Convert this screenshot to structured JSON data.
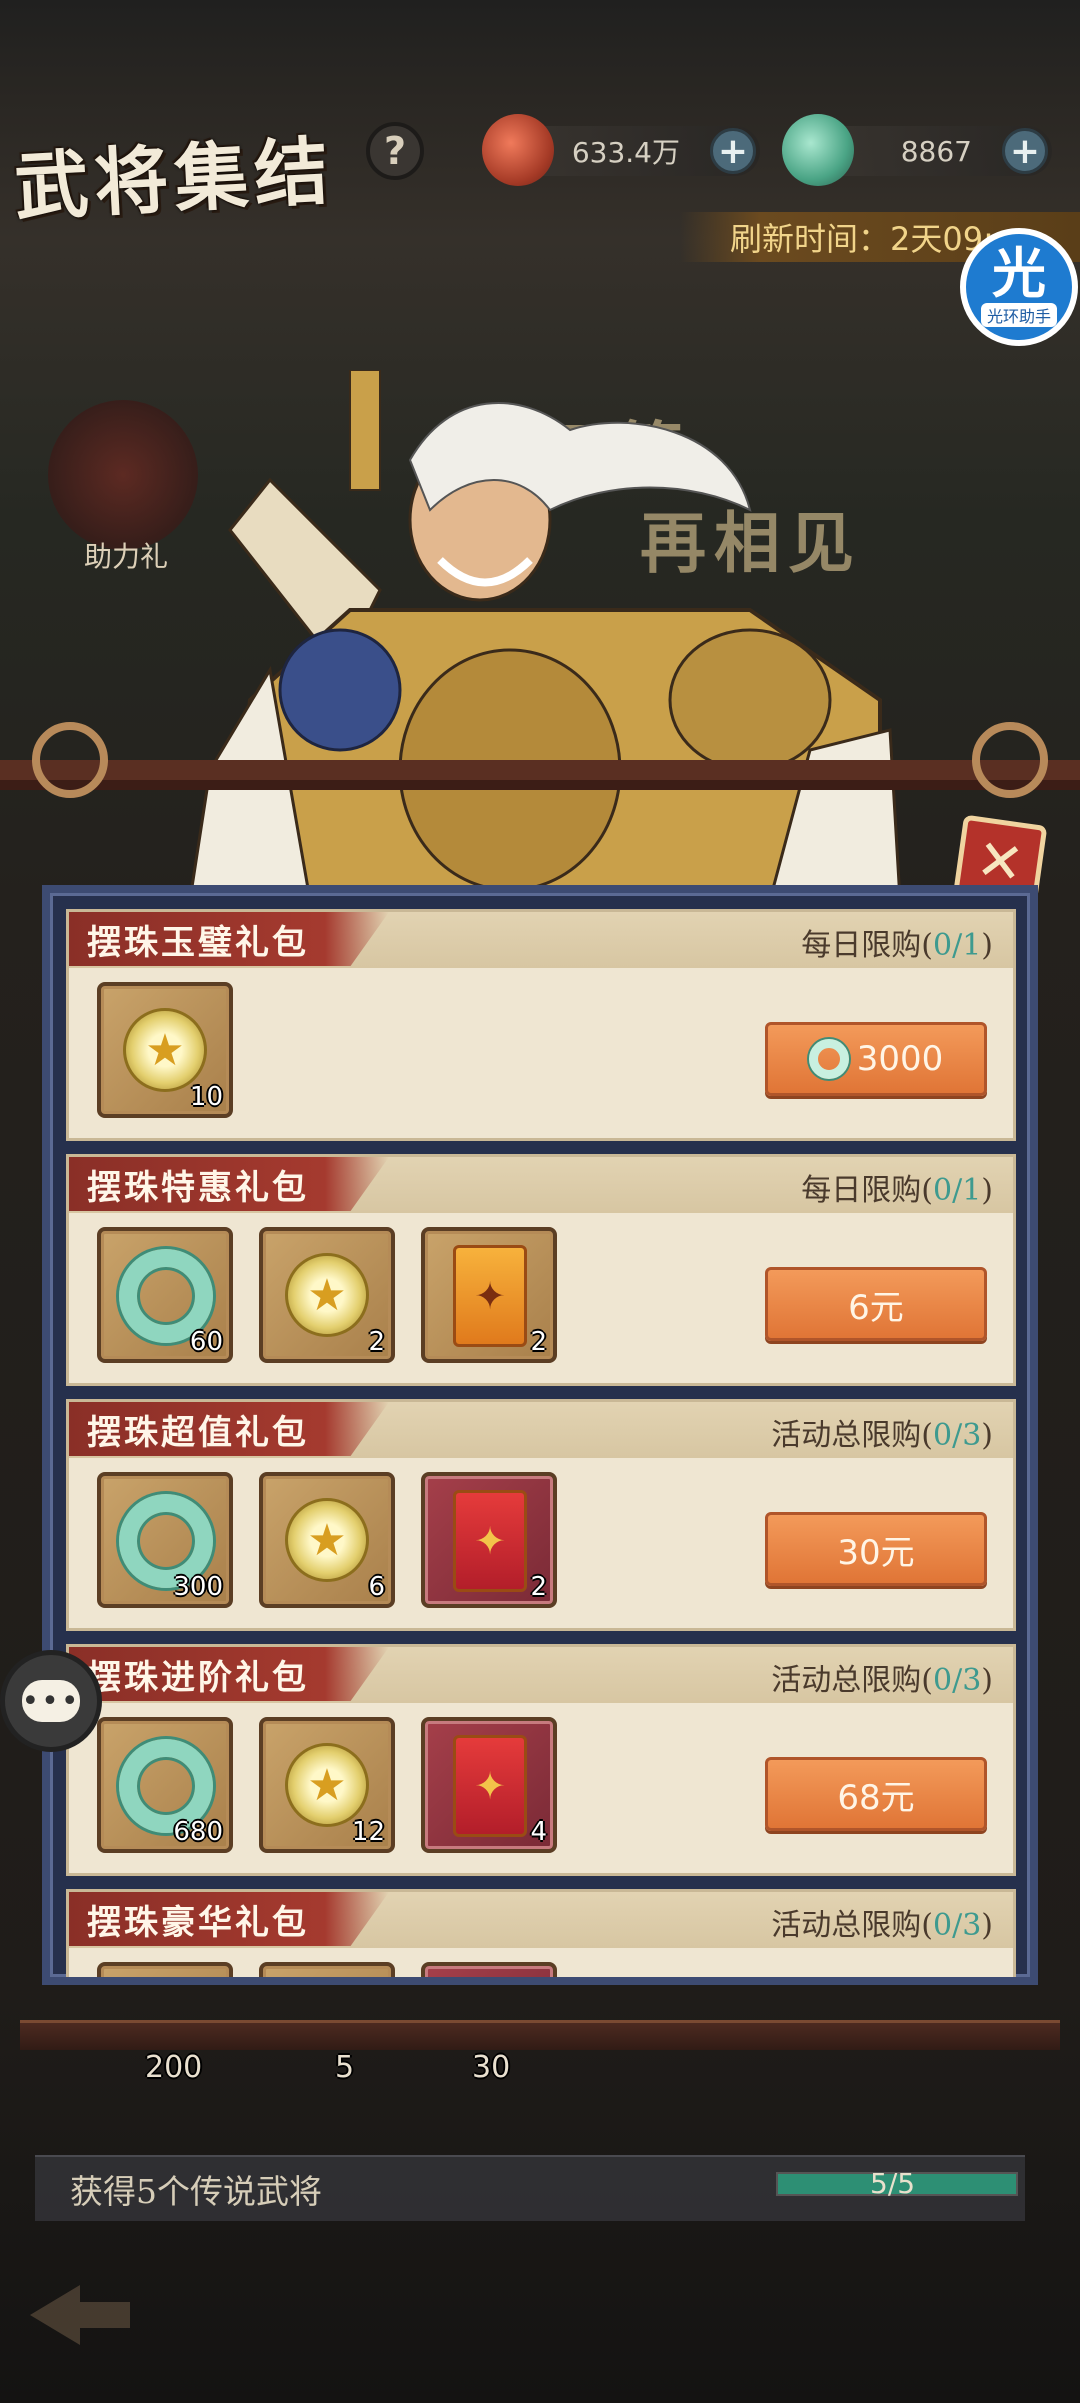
{
  "header": {
    "title": "武将集结",
    "help_label": "?",
    "copper_value": "633.4万",
    "jade_value": "8867",
    "plus_label": "+",
    "refresh_text": "刷新时间：2天09:"
  },
  "helper": {
    "big": "光",
    "small": "光环助手"
  },
  "banner": {
    "slogan_line1": "一   云箭",
    "slogan_line2": "再相见",
    "assist_label": "助力礼"
  },
  "close_label": "✕",
  "packs": [
    {
      "title": "摆珠玉璧礼包",
      "limit_label": "每日限购",
      "limit_count": "0/1",
      "price": "3000",
      "items": [
        {
          "kind": "coin",
          "qty": "10"
        }
      ]
    },
    {
      "title": "摆珠特惠礼包",
      "limit_label": "每日限购",
      "limit_count": "0/1",
      "price": "6元",
      "items": [
        {
          "kind": "jade",
          "qty": "60"
        },
        {
          "kind": "coin",
          "qty": "2"
        },
        {
          "kind": "pouch",
          "qty": "2"
        }
      ]
    },
    {
      "title": "摆珠超值礼包",
      "limit_label": "活动总限购",
      "limit_count": "0/3",
      "price": "30元",
      "items": [
        {
          "kind": "jade",
          "qty": "300"
        },
        {
          "kind": "coin",
          "qty": "6"
        },
        {
          "kind": "pouch-red",
          "qty": "2"
        }
      ]
    },
    {
      "title": "摆珠进阶礼包",
      "limit_label": "活动总限购",
      "limit_count": "0/3",
      "price": "68元",
      "items": [
        {
          "kind": "jade",
          "qty": "680"
        },
        {
          "kind": "coin",
          "qty": "12"
        },
        {
          "kind": "pouch-red",
          "qty": "4"
        }
      ]
    },
    {
      "title": "摆珠豪华礼包",
      "limit_label": "活动总限购",
      "limit_count": "0/3",
      "price": "",
      "items": []
    }
  ],
  "background_items": {
    "q1": "200",
    "q2": "5",
    "q3": "30"
  },
  "goal": {
    "text": "获得5个传说武将",
    "progress_text": "5/5",
    "progress": 1.0
  },
  "chat_label": "•••",
  "colors": {
    "limit_count": "#3e9a8f",
    "pack_title_bg": "#a53a2f",
    "buy_button": "#e98a4a"
  }
}
